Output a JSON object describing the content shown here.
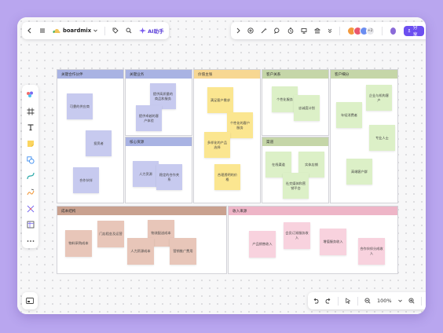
{
  "app": {
    "name": "boardmix",
    "ai_label": "AI助手"
  },
  "header": {
    "share_label": "分享",
    "avatar_count": "+2"
  },
  "zoom": {
    "level": "100%"
  },
  "colors": {
    "bg": "#b9a6ef",
    "accent": "#6c4ff0",
    "blue_header": "#a9b3e3",
    "blue_note": "#c7caef",
    "yellow_header": "#f7d792",
    "yellow_note": "#fbe690",
    "green_header": "#c5d6a8",
    "green_note": "#dcf0c7",
    "brown_header": "#c9a18f",
    "brown_note": "#e8c6b9",
    "pink_header": "#eeb5c7",
    "pink_note": "#f8d2de"
  },
  "frames": [
    {
      "title": "关键合作伙伴",
      "notes": [
        "可靠的供应商",
        "投资者",
        "合作伙伴"
      ]
    },
    {
      "title": "关键业务",
      "notes": [
        "提供高质量的商品和服务",
        "提供卓越的客户体验"
      ]
    },
    {
      "title": "核心资源",
      "notes": [
        "人力资源",
        "稳定的合作关系"
      ]
    },
    {
      "title": "价值主张",
      "notes": [
        "满足客户需求",
        "个性化的客户服务",
        "多样化的产品选择",
        "合理透明的价格"
      ]
    },
    {
      "title": "客户关系",
      "notes": [
        "个性化服务",
        "忠诚度计划"
      ]
    },
    {
      "title": "渠道",
      "notes": [
        "在线渠道",
        "实体店铺",
        "社交媒体和营销平台"
      ]
    },
    {
      "title": "客户细分",
      "notes": [
        "年轻消费者",
        "企业与机构客户",
        "专业人士",
        "高端客户群"
      ]
    },
    {
      "title": "成本结构",
      "notes": [
        "物料采购成本",
        "门店租金及运营",
        "物流配送成本",
        "人力资源成本",
        "营销推广费用"
      ]
    },
    {
      "title": "收入来源",
      "notes": [
        "产品销售收入",
        "会员订阅服务收入",
        "增值服务收入",
        "合作伙伴分成收入"
      ]
    }
  ]
}
